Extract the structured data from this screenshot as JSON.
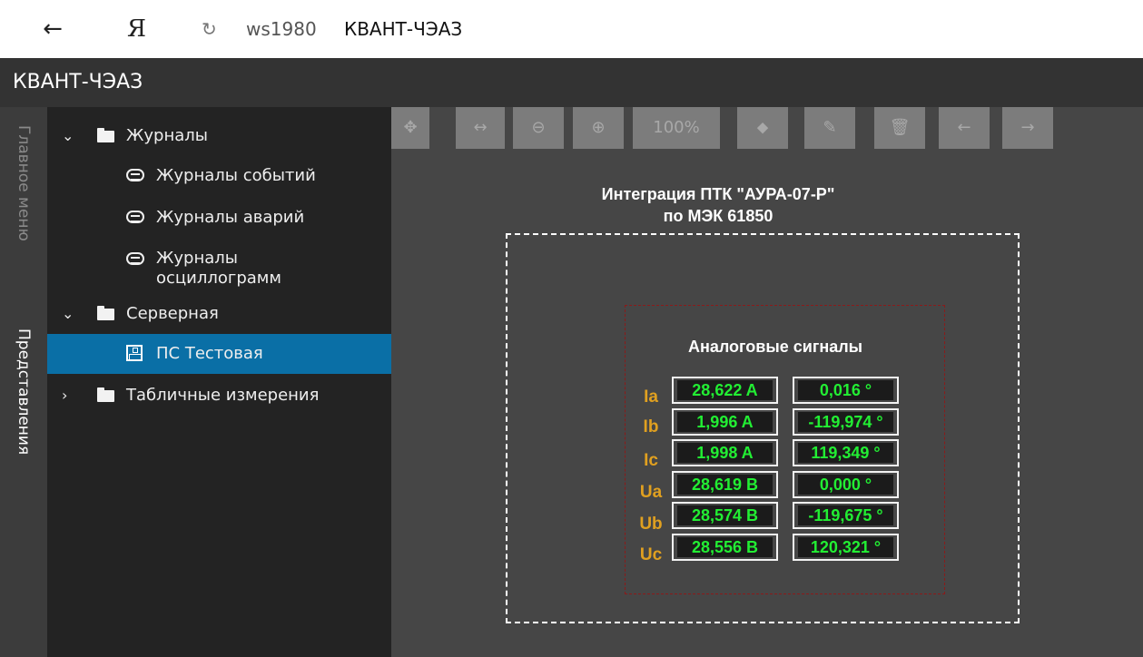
{
  "browser": {
    "back_icon": "←",
    "yandex_logo": "Я",
    "reload_icon": "↻",
    "host": "ws1980",
    "page_title": "КВАНТ-ЧЭАЗ"
  },
  "app": {
    "title": "КВАНТ-ЧЭАЗ"
  },
  "side_tabs": {
    "main_menu": "Главное меню",
    "views": "Представления"
  },
  "tree": {
    "expanded_icon": "⌄",
    "collapsed_icon": "›",
    "journals": "Журналы",
    "event_journals": "Журналы событий",
    "alarm_journals": "Журналы аварий",
    "oscillogram_journals": "Журналы осциллограмм",
    "server": "Серверная",
    "test_substation": "ПС Тестовая",
    "table_measurements": "Табличные измерения"
  },
  "toolbar": {
    "move_icon": "✥",
    "fit_width_icon": "↔",
    "zoom_out_icon": "⊖",
    "zoom_in_icon": "⊕",
    "zoom_level": "100%",
    "tag_icon": "⬥",
    "edit_icon": "✎",
    "delete_icon": "🗑",
    "back_icon": "←",
    "forward_icon": "→"
  },
  "scheme": {
    "title_line1": "Интеграция ПТК \"АУРА-07-Р\"",
    "title_line2": "по МЭК 61850",
    "signals_title": "Аналоговые сигналы",
    "rows": [
      {
        "label": "Ia",
        "magnitude": "28,622 A",
        "angle": "0,016 °"
      },
      {
        "label": "Ib",
        "magnitude": "1,996 A",
        "angle": "-119,974 °"
      },
      {
        "label": "Ic",
        "magnitude": "1,998 A",
        "angle": "119,349 °"
      },
      {
        "label": "Ua",
        "magnitude": "28,619 В",
        "angle": "0,000 °"
      },
      {
        "label": "Ub",
        "magnitude": "28,574 В",
        "angle": "-119,675 °"
      },
      {
        "label": "Uc",
        "magnitude": "28,556 В",
        "angle": "120,321 °"
      }
    ]
  },
  "colors": {
    "header_bg": "#333333",
    "sidebar_bg": "#232323",
    "selected_bg": "#0a6fa6",
    "canvas_bg": "#464646",
    "value_green": "#22ee33",
    "label_orange": "#e0a020"
  }
}
